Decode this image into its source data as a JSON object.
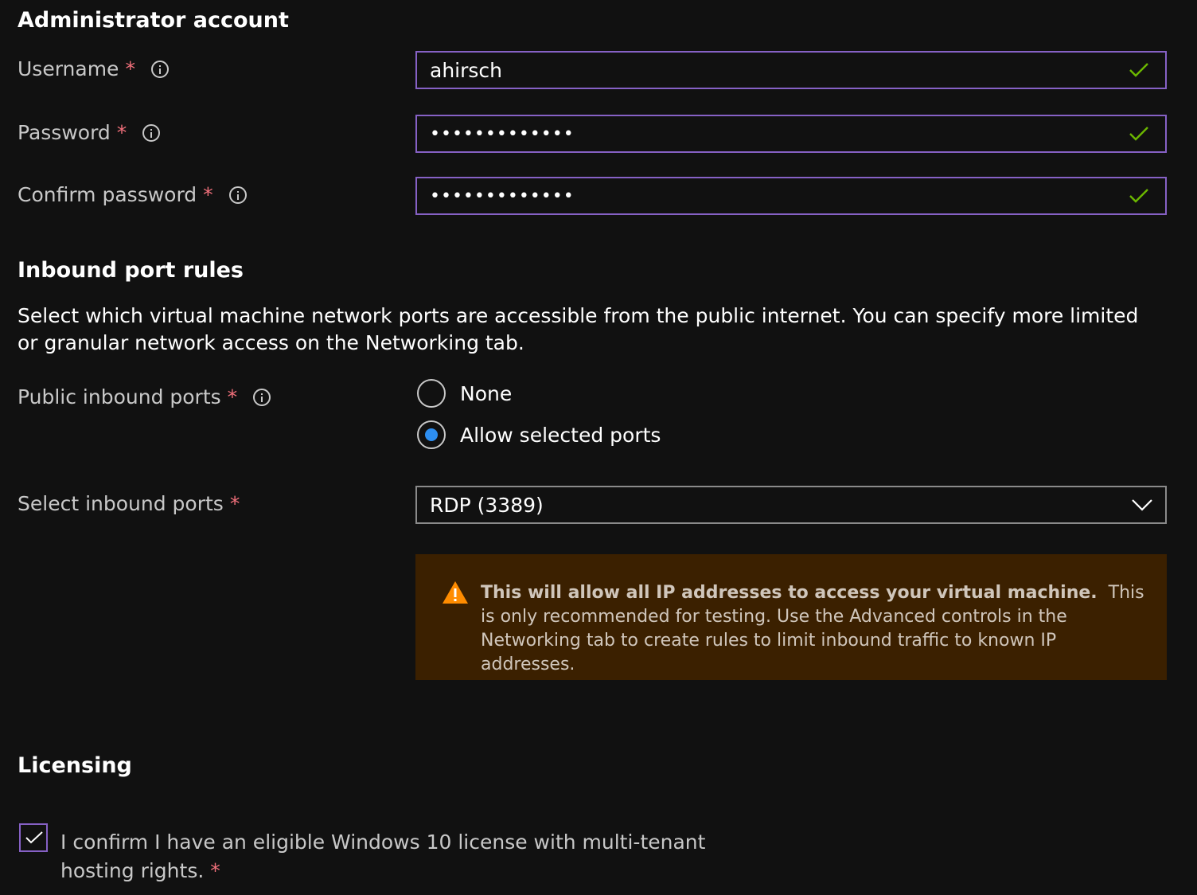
{
  "admin": {
    "heading": "Administrator account",
    "username": {
      "label": "Username",
      "value": "ahirsch"
    },
    "password": {
      "label": "Password",
      "value": "•••••••••••••"
    },
    "confirm": {
      "label": "Confirm password",
      "value": "•••••••••••••"
    }
  },
  "required_mark": "*",
  "inbound": {
    "heading": "Inbound port rules",
    "description": "Select which virtual machine network ports are accessible from the public internet. You can specify more limited or granular network access on the Networking tab.",
    "public_ports": {
      "label": "Public inbound ports",
      "options": [
        {
          "label": "None",
          "selected": false
        },
        {
          "label": "Allow selected ports",
          "selected": true
        }
      ]
    },
    "select_ports": {
      "label": "Select inbound ports",
      "value": "RDP (3389)"
    },
    "warning": {
      "bold": "This will allow all IP addresses to access your virtual machine.",
      "text": "This is only recommended for testing.  Use the Advanced controls in the Networking tab to create rules to limit inbound traffic to known IP addresses."
    }
  },
  "licensing": {
    "heading": "Licensing",
    "confirm_text": "I confirm I have an eligible Windows 10 license with multi-tenant hosting rights.",
    "checked": true
  },
  "colors": {
    "background": "#111111",
    "field_border": "#8661c5",
    "valid_check": "#6bb700",
    "required": "#f1707b",
    "radio_selected": "#2d8ef0",
    "warning_bg": "#3b2000",
    "warning_icon": "#ff8c00"
  },
  "icons": [
    "info-icon",
    "valid-check-icon",
    "chevron-down-icon",
    "warning-icon",
    "checkbox-check-icon"
  ]
}
